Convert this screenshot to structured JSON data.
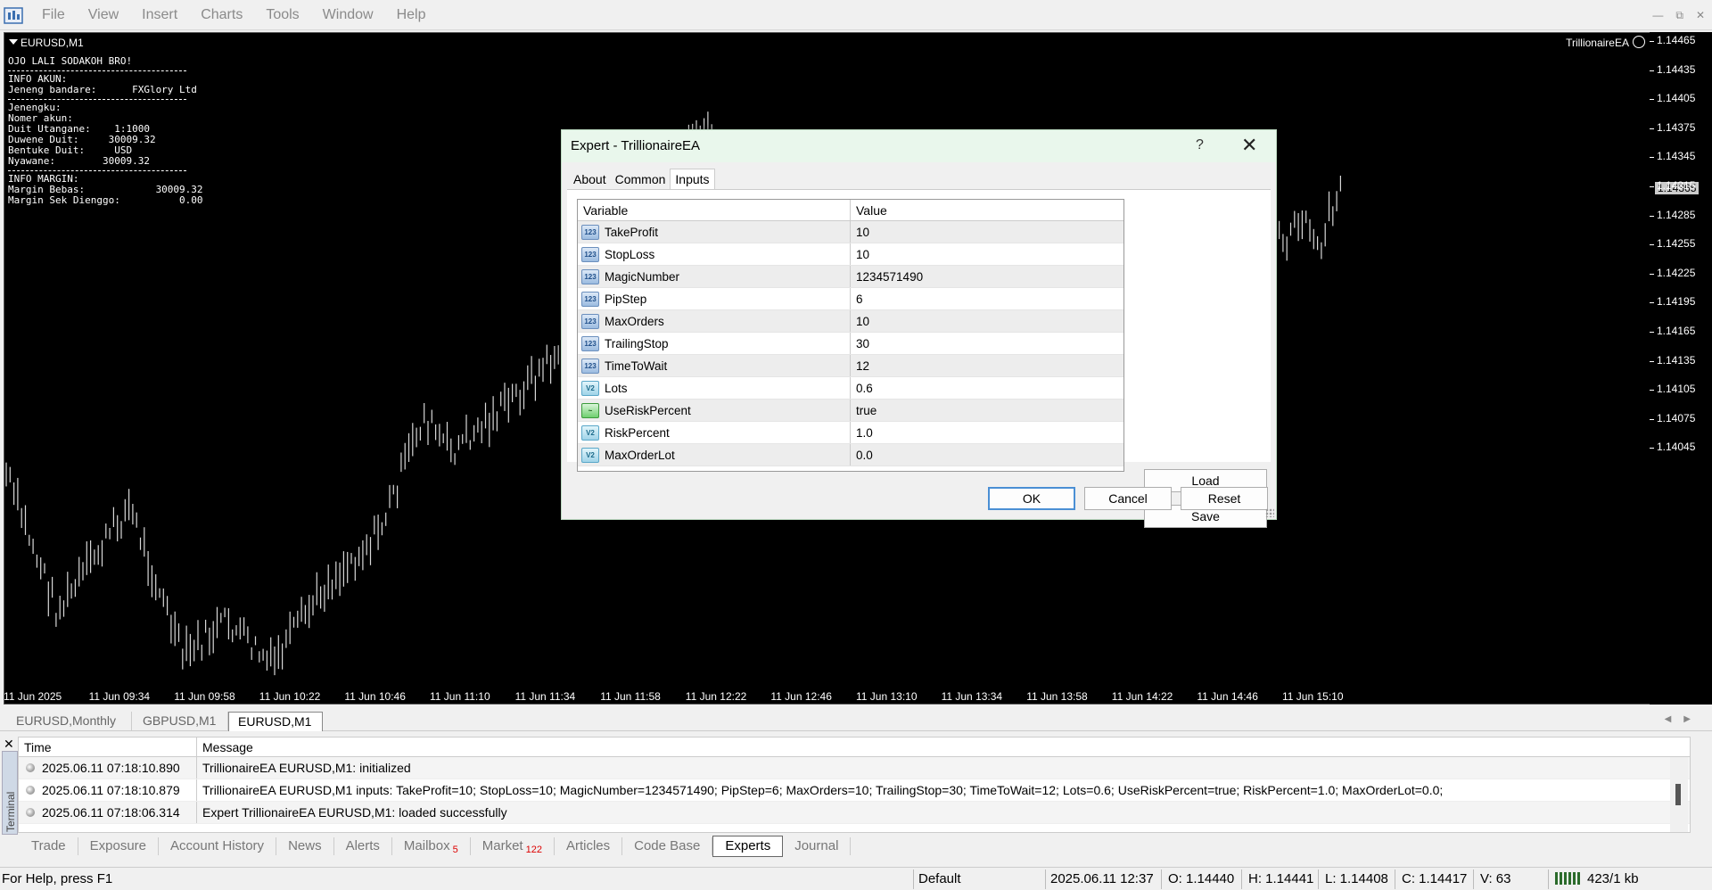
{
  "menu": {
    "items": [
      "File",
      "View",
      "Insert",
      "Charts",
      "Tools",
      "Window",
      "Help"
    ]
  },
  "chart": {
    "symbol": "EURUSD,M1",
    "ea_name": "TrillionaireEA",
    "info_lines": [
      {
        "text": "OJO LALI SODAKOH BRO!"
      },
      {
        "sep": true
      },
      {
        "text": "INFO AKUN:"
      },
      {
        "text": "Jeneng bandare:      FXGlory Ltd"
      },
      {
        "sep": true
      },
      {
        "text": "Jenengku:"
      },
      {
        "text": "Nomer akun:"
      },
      {
        "text": "Duit Utangane:    1:1000"
      },
      {
        "text": "Duwene Duit:     30009.32"
      },
      {
        "text": "Bentuke Duit:     USD"
      },
      {
        "text": "Nyawane:        30009.32"
      },
      {
        "sep": true
      },
      {
        "text": "INFO MARGIN:"
      },
      {
        "text": "Margin Bebas:            30009.32"
      },
      {
        "text": "Margin Sek Dienggo:          0.00"
      }
    ],
    "price_labels": [
      "1.14465",
      "1.14435",
      "1.14405",
      "1.14375",
      "1.14345",
      "1.14315",
      "1.14285",
      "1.14255",
      "1.14225",
      "1.14195",
      "1.14165",
      "1.14135",
      "1.14105",
      "1.14075",
      "1.14045"
    ],
    "current_price": "1.14365",
    "time_labels": [
      "11 Jun 2025",
      "11 Jun 09:34",
      "11 Jun 09:58",
      "11 Jun 10:22",
      "11 Jun 10:46",
      "11 Jun 11:10",
      "11 Jun 11:34",
      "11 Jun 11:58",
      "11 Jun 12:22",
      "11 Jun 12:46",
      "11 Jun 13:10",
      "11 Jun 13:34",
      "11 Jun 13:58",
      "11 Jun 14:22",
      "11 Jun 14:46",
      "11 Jun 15:10"
    ]
  },
  "chart_tabs": [
    "EURUSD,Monthly",
    "GBPUSD,M1",
    "EURUSD,M1"
  ],
  "dialog": {
    "title": "Expert - TrillionaireEA",
    "help": "?",
    "tabs": [
      "About",
      "Common",
      "Inputs"
    ],
    "columns": {
      "variable": "Variable",
      "value": "Value"
    },
    "inputs": [
      {
        "name": "TakeProfit",
        "value": "10",
        "icon": "int-icon"
      },
      {
        "name": "StopLoss",
        "value": "10",
        "icon": "int-icon"
      },
      {
        "name": "MagicNumber",
        "value": "1234571490",
        "icon": "int-icon"
      },
      {
        "name": "PipStep",
        "value": "6",
        "icon": "int-icon"
      },
      {
        "name": "MaxOrders",
        "value": "10",
        "icon": "int-icon"
      },
      {
        "name": "TrailingStop",
        "value": "30",
        "icon": "int-icon"
      },
      {
        "name": "TimeToWait",
        "value": "12",
        "icon": "int-icon"
      },
      {
        "name": "Lots",
        "value": "0.6",
        "icon": "double-icon"
      },
      {
        "name": "UseRiskPercent",
        "value": "true",
        "icon": "bool-icon"
      },
      {
        "name": "RiskPercent",
        "value": "1.0",
        "icon": "double-icon"
      },
      {
        "name": "MaxOrderLot",
        "value": "0.0",
        "icon": "double-icon"
      }
    ],
    "buttons": {
      "load": "Load",
      "save": "Save",
      "ok": "OK",
      "cancel": "Cancel",
      "reset": "Reset"
    }
  },
  "terminal": {
    "side_label": "Terminal",
    "columns": {
      "time": "Time",
      "message": "Message"
    },
    "rows": [
      {
        "time": "2025.06.11 07:18:10.890",
        "message": "TrillionaireEA EURUSD,M1: initialized"
      },
      {
        "time": "2025.06.11 07:18:10.879",
        "message": "TrillionaireEA EURUSD,M1 inputs: TakeProfit=10; StopLoss=10; MagicNumber=1234571490; PipStep=6; MaxOrders=10; TrailingStop=30; TimeToWait=12; Lots=0.6; UseRiskPercent=true; RiskPercent=1.0; MaxOrderLot=0.0;"
      },
      {
        "time": "2025.06.11 07:18:06.314",
        "message": "Expert TrillionaireEA EURUSD,M1: loaded successfully"
      }
    ],
    "tabs": [
      {
        "label": "Trade"
      },
      {
        "label": "Exposure"
      },
      {
        "label": "Account History"
      },
      {
        "label": "News"
      },
      {
        "label": "Alerts"
      },
      {
        "label": "Mailbox",
        "badge": "5"
      },
      {
        "label": "Market",
        "badge": "122"
      },
      {
        "label": "Articles"
      },
      {
        "label": "Code Base"
      },
      {
        "label": "Experts",
        "active": true
      },
      {
        "label": "Journal"
      }
    ]
  },
  "status": {
    "help": "For Help, press F1",
    "profile": "Default",
    "datetime": "2025.06.11 12:37",
    "open": "O: 1.14440",
    "high": "H: 1.14441",
    "low": "L: 1.14408",
    "close": "C: 1.14417",
    "volume": "V: 63",
    "traffic": "423/1 kb"
  }
}
